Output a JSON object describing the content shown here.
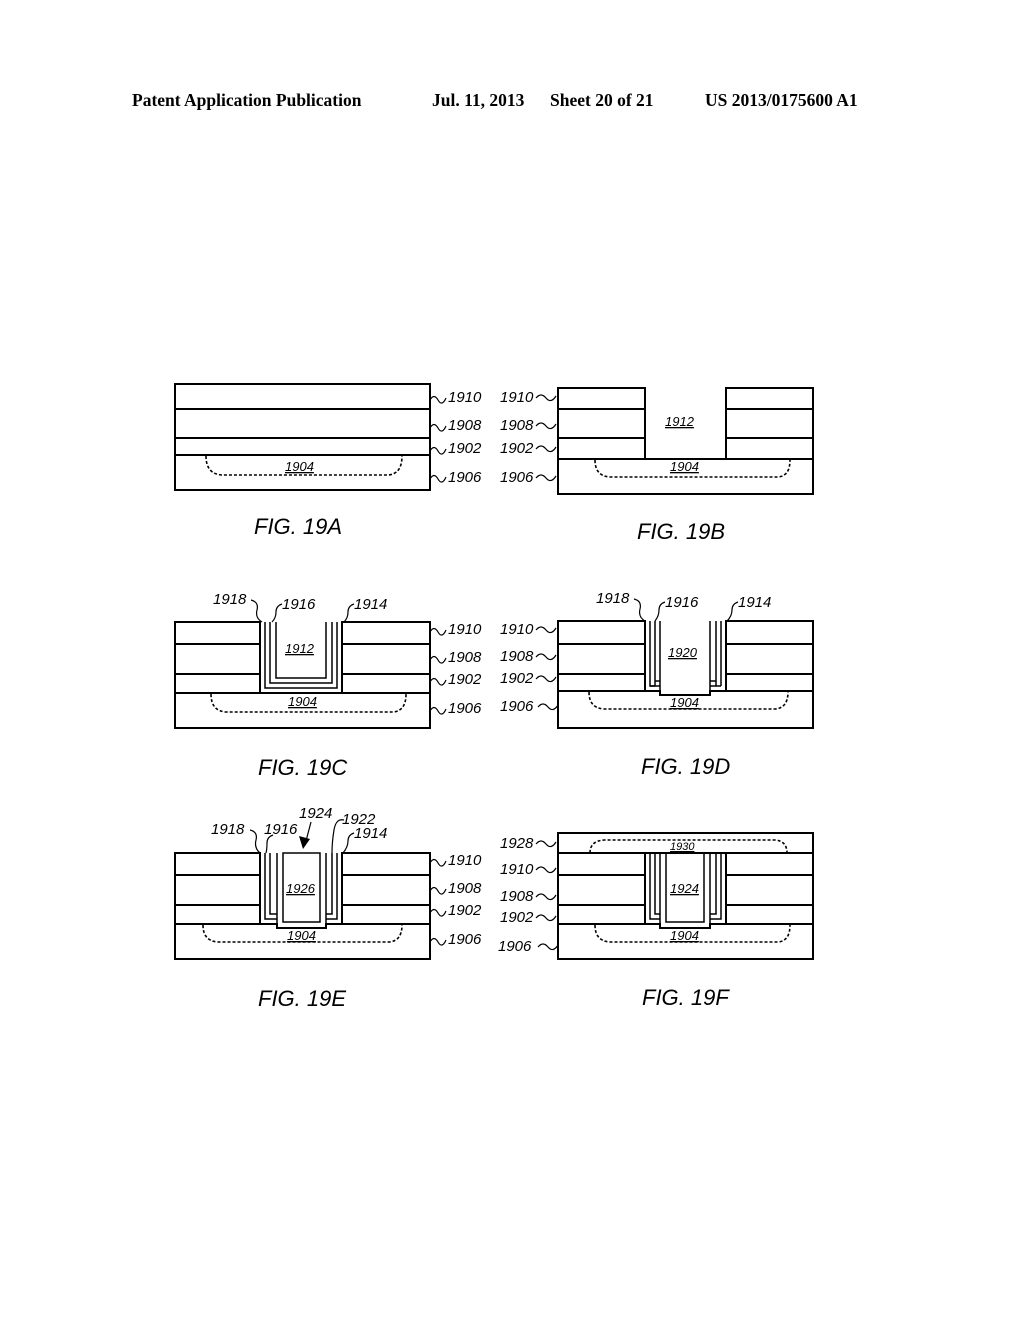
{
  "header": {
    "publication": "Patent Application Publication",
    "date": "Jul. 11, 2013",
    "sheet": "Sheet 20 of 21",
    "number": "US 2013/0175600 A1"
  },
  "figures": {
    "a": {
      "caption": "FIG. 19A",
      "labels": {
        "l1910": "1910",
        "l1908": "1908",
        "l1902": "1902",
        "l1906": "1906",
        "l1904": "1904"
      }
    },
    "b": {
      "caption": "FIG. 19B",
      "labels": {
        "l1910": "1910",
        "l1908": "1908",
        "l1902": "1902",
        "l1906": "1906",
        "l1904": "1904",
        "l1912": "1912"
      }
    },
    "c": {
      "caption": "FIG. 19C",
      "labels": {
        "l1910": "1910",
        "l1908": "1908",
        "l1902": "1902",
        "l1906": "1906",
        "l1904": "1904",
        "l1912": "1912",
        "l1918": "1918",
        "l1916": "1916",
        "l1914": "1914"
      }
    },
    "d": {
      "caption": "FIG. 19D",
      "labels": {
        "l1910": "1910",
        "l1908": "1908",
        "l1902": "1902",
        "l1906": "1906",
        "l1904": "1904",
        "l1920": "1920",
        "l1918": "1918",
        "l1916": "1916",
        "l1914": "1914"
      }
    },
    "e": {
      "caption": "FIG. 19E",
      "labels": {
        "l1910": "1910",
        "l1908": "1908",
        "l1902": "1902",
        "l1906": "1906",
        "l1904": "1904",
        "l1926": "1926",
        "l1924": "1924",
        "l1922": "1922",
        "l1918": "1918",
        "l1916": "1916",
        "l1914": "1914"
      }
    },
    "f": {
      "caption": "FIG. 19F",
      "labels": {
        "l1928": "1928",
        "l1910": "1910",
        "l1908": "1908",
        "l1902": "1902",
        "l1906": "1906",
        "l1904": "1904",
        "l1924": "1924",
        "l1930": "1930"
      }
    }
  }
}
